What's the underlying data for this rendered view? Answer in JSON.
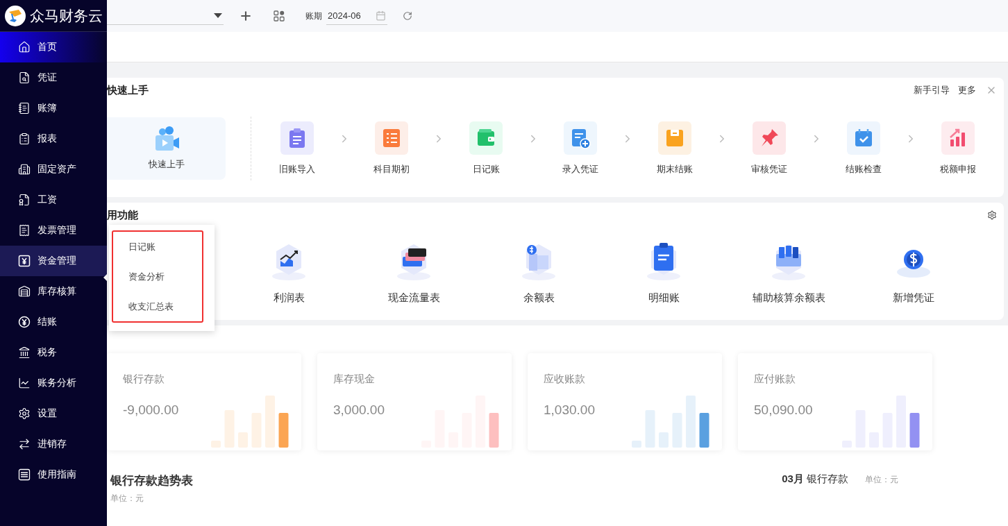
{
  "app": {
    "name": "众马财务云"
  },
  "sidebar": {
    "items": [
      {
        "label": "首页",
        "selected": true,
        "expanded": false
      },
      {
        "label": "凭证",
        "selected": false,
        "expanded": false
      },
      {
        "label": "账簿",
        "selected": false,
        "expanded": false
      },
      {
        "label": "报表",
        "selected": false,
        "expanded": false
      },
      {
        "label": "固定资产",
        "selected": false,
        "expanded": false
      },
      {
        "label": "工资",
        "selected": false,
        "expanded": false
      },
      {
        "label": "发票管理",
        "selected": false,
        "expanded": false
      },
      {
        "label": "资金管理",
        "selected": false,
        "expanded": true
      },
      {
        "label": "库存核算",
        "selected": false,
        "expanded": false
      },
      {
        "label": "结账",
        "selected": false,
        "expanded": false
      },
      {
        "label": "税务",
        "selected": false,
        "expanded": false
      },
      {
        "label": "账务分析",
        "selected": false,
        "expanded": false
      },
      {
        "label": "设置",
        "selected": false,
        "expanded": false
      },
      {
        "label": "进销存",
        "selected": false,
        "expanded": false
      },
      {
        "label": "使用指南",
        "selected": false,
        "expanded": false
      }
    ]
  },
  "topbar": {
    "period_label": "账期",
    "period": "2024-06"
  },
  "quick_start": {
    "title": "快速上手",
    "links": [
      "新手引导",
      "更多"
    ],
    "intro": "快速上手",
    "steps": [
      "旧账导入",
      "科目期初",
      "日记账",
      "录入凭证",
      "期末结账",
      "审核凭证",
      "结账检查",
      "税额申报"
    ]
  },
  "common_functions": {
    "title": "用功能",
    "items": [
      "利润表",
      "现金流量表",
      "余额表",
      "明细账",
      "辅助核算余额表",
      "新增凭证"
    ]
  },
  "popup": {
    "items": [
      "日记账",
      "资金分析",
      "收支汇总表"
    ]
  },
  "stats": [
    {
      "label": "银行存款",
      "value": "-9,000.00",
      "color": "#fba553"
    },
    {
      "label": "库存现金",
      "value": "3,000.00",
      "color": "#fdbfbf"
    },
    {
      "label": "应收账款",
      "value": "1,030.00",
      "color": "#5aa0e0"
    },
    {
      "label": "应付账款",
      "value": "50,090.00",
      "color": "#9391f2"
    }
  ],
  "trend": {
    "title": "银行存款趋势表",
    "unit": "单位：元",
    "month": "03月",
    "series_label": "银行存款",
    "unit_right": "单位：元"
  }
}
